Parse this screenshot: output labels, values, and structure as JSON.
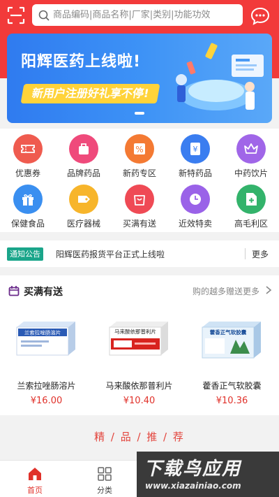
{
  "header": {
    "search_placeholder": "商品编码|商品名称|厂家|类别|功能功效",
    "accent": "#f23a3a"
  },
  "banner": {
    "title": "阳辉医药上线啦!",
    "subtitle": "新用户注册好礼享不停!",
    "current_slide": 1
  },
  "categories": [
    {
      "label": "优惠券",
      "color": "#ef5b4f",
      "icon": "coupon-icon"
    },
    {
      "label": "品牌药品",
      "color": "#ef4a7b",
      "icon": "bag-icon"
    },
    {
      "label": "新药专区",
      "color": "#f47a33",
      "icon": "percent-icon"
    },
    {
      "label": "新特药品",
      "color": "#3a7df0",
      "icon": "yen-icon"
    },
    {
      "label": "中药饮片",
      "color": "#a066e8",
      "icon": "crown-icon"
    },
    {
      "label": "保健食品",
      "color": "#3a8ff0",
      "icon": "gift-icon"
    },
    {
      "label": "医疗器械",
      "color": "#f7b52b",
      "icon": "tag-icon"
    },
    {
      "label": "买满有送",
      "color": "#ef4a55",
      "icon": "shopping-bag-icon"
    },
    {
      "label": "近效特卖",
      "color": "#9a62e8",
      "icon": "clock-icon"
    },
    {
      "label": "高毛利区",
      "color": "#33b36b",
      "icon": "plus-doc-icon"
    }
  ],
  "notice": {
    "tag": "通知公告",
    "text": "阳辉医药报货平台正式上线啦",
    "more": "更多"
  },
  "promo": {
    "title": "买满有送",
    "more": "购的越多赠送更多",
    "products": [
      {
        "name": "兰索拉唑肠溶片",
        "price": "¥16.00",
        "box_label": "兰索拉唑肠溶片"
      },
      {
        "name": "马来酸依那普利片",
        "price": "¥10.40",
        "box_label": "马来酸依那普利片"
      },
      {
        "name": "藿香正气软胶囊",
        "price": "¥10.36",
        "box_label": "藿香正气软胶囊"
      }
    ]
  },
  "recommend": {
    "title": "精 / 品 / 推 / 荐"
  },
  "nav": {
    "items": [
      {
        "label": "首页",
        "active": true
      },
      {
        "label": "分类",
        "active": false
      }
    ]
  },
  "watermark": {
    "big": "下载鸟应用",
    "small": "www.xiazainiao.com"
  }
}
